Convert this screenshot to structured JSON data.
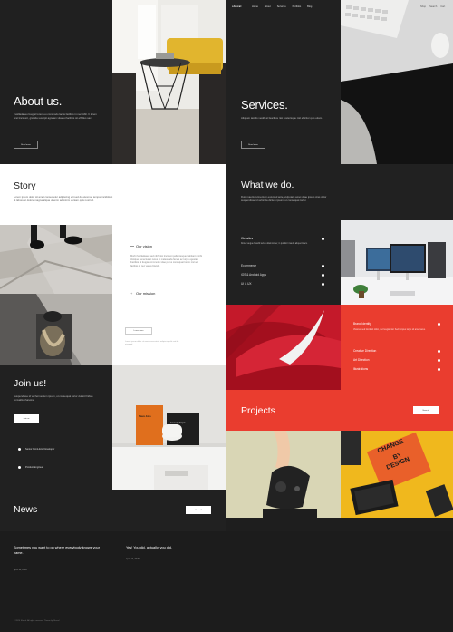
{
  "colors": {
    "bg_dark": "#1e1e1e",
    "panel": "#252525",
    "accent": "#ea3d2f",
    "white": "#ffffff"
  },
  "left_header": {
    "logo": "sheral",
    "nav": [
      "Home",
      "About",
      "Services",
      "Portfolio",
      "Blog"
    ]
  },
  "right_header": {
    "logo": "sheral",
    "nav": [
      "Home",
      "About",
      "Services",
      "Portfolio",
      "Blog"
    ],
    "extras": [
      "Shop",
      "Search",
      "Cart"
    ]
  },
  "about": {
    "title": "About us.",
    "text": "Fusilladaseu feugiat lorem eu commodo lacus facilisis in nec nibh. It lorem erat tincidunt, gravida suscipit agneam vitae et facilisis sit effidius sac.",
    "button": "Read more"
  },
  "services": {
    "title": "Services.",
    "text": "Aliquam iaculis vestib at faucibus nisi scelerisque nisl efficitur quis etiam.",
    "button": "Read more"
  },
  "story": {
    "title": "Story",
    "text": "Lorem ipsum dolor sit amet consectetur adipiscing elit sed do eiusmod tempor incididunt ut labore et dolore magna aliqua ut enim ad minim veniam quis nostrud."
  },
  "vision": {
    "title": "Our vision",
    "text": "Morbi fusilladaseu sed nibh nisi tincidunt pellentesque habitant morbi tristique senectus et netus et malesuada fames ac turpis egestas. Facilisis ut feugiat commodo vitae purus consequat lorem nisl ac facilisis in nec varius blandit.",
    "mission": "Our mission",
    "button": "Learn more"
  },
  "footnote": "Lorem ipsum dolor sit amet consectetur adipiscing elit sed do eiusmod",
  "what_we_do": {
    "title": "What we do.",
    "text": "Duis mauris fermentum euismod ante, vulputate amet vitae ipsum cras dolor suspendisse id vehicula dictum ipsum, ut consequat tortor.",
    "items": [
      "Websites",
      "Ecommerce",
      "iOS & Android Apps",
      "UI & UX"
    ],
    "desc": "Donec augue blandit lectus ullamcorper, in porttitor mauris aliquet lorem."
  },
  "brand": {
    "items": [
      "Brand Identity",
      "Creative Direction",
      "Art Direction",
      "Illustrations"
    ],
    "desc": "Vivamus sed tincidunt dolor, nec feugiat nisl. Sed tempus turpis sit amet lacus."
  },
  "join": {
    "title": "Join us!",
    "text": "Suspendisse id vel fermentum ipsum, ut consequat tortor dui sit finibus convallis pharetra.",
    "button": "Join us",
    "items": [
      "Senior Front-End Developer",
      "Product Engineer"
    ]
  },
  "projects": {
    "title": "Projects",
    "button": "View all"
  },
  "poster_text": [
    "CHANGE",
    "BY",
    "DESIGN"
  ],
  "book_text": [
    "Steve Jobs",
    "Insanely Simple"
  ],
  "news": {
    "title": "News",
    "button": "View all",
    "posts": [
      {
        "title": "Sometimes you want to go where everybody knows your name.",
        "date": "April 14, 2020"
      },
      {
        "title": "Yes! You did, actually, you did.",
        "date": "April 14, 2020"
      }
    ]
  },
  "footer": {
    "text": "© 2020 Sheral. All rights reserved. Theme by Sheral"
  }
}
